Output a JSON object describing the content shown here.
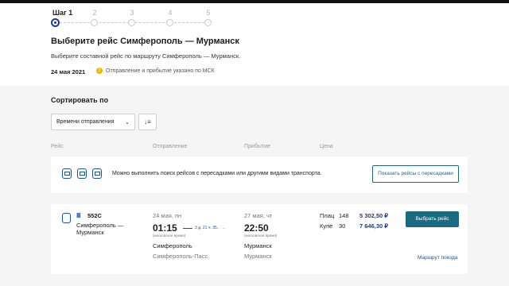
{
  "steps": [
    {
      "label": "Шаг 1",
      "active": true
    },
    {
      "label": "2",
      "active": false
    },
    {
      "label": "3",
      "active": false
    },
    {
      "label": "4",
      "active": false
    },
    {
      "label": "5",
      "active": false
    }
  ],
  "header": {
    "title": "Выберите рейс Симферополь — Мурманск",
    "subtitle": "Выберите составной рейс по маршруту Симферополь — Мурманск.",
    "date": "24 мая 2021",
    "tz_note": "Отправление и прибытие указано по МСК"
  },
  "sort": {
    "title": "Сортировать по",
    "selected": "Времени отправления"
  },
  "columns": {
    "trip": "Рейс",
    "departure": "Отправление",
    "arrival": "Прибытие",
    "price": "Цена"
  },
  "info": {
    "text": "Можно выполнить поиск рейсов с пересадками или другими видами транспорта.",
    "button": "Показать рейсы с пересадками"
  },
  "trip": {
    "number": "552С",
    "route": "Симферополь — Мурманск",
    "dep_date": "24 мая, пн",
    "dep_time": "01:15",
    "dep_note": "(московское время)",
    "duration": "3 д. 21 ч. 35..",
    "arr_date": "27 мая, чт",
    "arr_time": "22:50",
    "arr_note": "(московское время)",
    "dep_city": "Симферополь",
    "dep_station": "Симферополь-Пасс.",
    "arr_city": "Мурманск",
    "arr_station": "Мурманск",
    "classes": [
      {
        "name": "Плац",
        "count": "148",
        "price": "5 302,50 ₽"
      },
      {
        "name": "Купе",
        "count": "30",
        "price": "7 646,30 ₽"
      }
    ],
    "choose_button": "Выбрать рейс",
    "route_link": "Маршрут поезда"
  },
  "colors": {
    "accent": "#1a6b80",
    "brand_blue": "#1e3a8a",
    "warn": "#f2b705"
  }
}
